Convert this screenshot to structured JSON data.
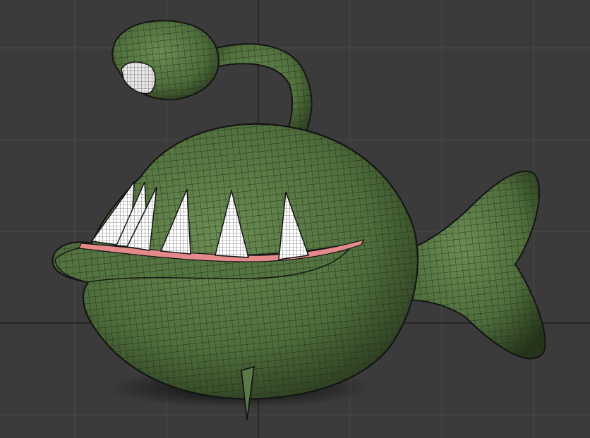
{
  "viewport": {
    "background": "#3b3b3b",
    "grid_color": "#4a4a4a",
    "axis_color": "#1a1a1a"
  },
  "model": {
    "body_color": "#5a7a45",
    "wire_color": "#1f2a17",
    "tooth_color": "#ffffff",
    "lip_color": "#e58a8a",
    "outline_color": "#141414"
  }
}
